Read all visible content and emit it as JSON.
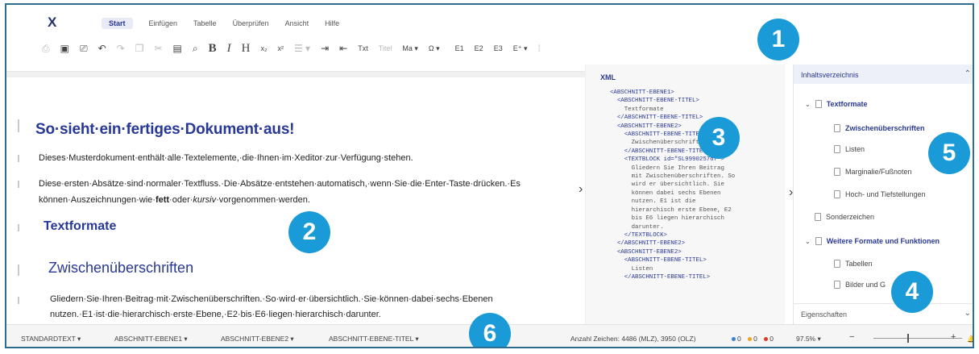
{
  "logo": "X",
  "menu": [
    "Start",
    "Einfügen",
    "Tabelle",
    "Überprüfen",
    "Ansicht",
    "Hilfe"
  ],
  "menu_active": 0,
  "toolbar": {
    "txt": "Txt",
    "titel": "Titel",
    "ma": "Ma ▾",
    "e1": "E1",
    "e2": "E2",
    "e3": "E3",
    "eplus": "E⁺ ▾",
    "h": "H",
    "b": "B",
    "i": "I",
    "sub": "x₂",
    "sup": "x²"
  },
  "editor": {
    "title": "So·sieht·ein·fertiges·Dokument·aus!",
    "p1": "Dieses·Musterdokument·enthält·alle·Textelemente,·die·Ihnen·im·Xeditor·zur·Verfügung·stehen.",
    "p2_line1": "Diese·ersten·Absätze·sind·normaler·Textfluss.·Die·Absätze·entstehen·automatisch,·wenn·Sie·die·Enter-Taste·drücken.·Es",
    "p2_line2_a": "können·Auszeichnungen·wie·",
    "p2_bold": "fett",
    "p2_line2_b": "·oder·",
    "p2_italic": "kursiv",
    "p2_line2_c": "·vorgenommen·werden.",
    "h2": "Textformate",
    "h3": "Zwischenüberschriften",
    "p3_line1": "Gliedern·Sie·Ihren·Beitrag·mit·Zwischenüberschriften.·So·wird·er·übersichtlich.·Sie·können·dabei·sechs·Ebenen",
    "p3_line2": "nutzen.·E1·ist·die·hierarchisch·erste·Ebene,·E2·bis·E6·liegen·hierarchisch·darunter."
  },
  "xml": {
    "title": "XML",
    "lines": [
      {
        "t": "tag",
        "v": "<ABSCHNITT-EBENE1>"
      },
      {
        "t": "tag",
        "v": "  <ABSCHNITT-EBENE-TITEL>"
      },
      {
        "t": "txt",
        "v": "    Textformate"
      },
      {
        "t": "tag",
        "v": "  </ABSCHNITT-EBENE-TITEL>"
      },
      {
        "t": "tag",
        "v": "  <ABSCHNITT-EBENE2>"
      },
      {
        "t": "tag",
        "v": "    <ABSCHNITT-EBENE-TITEL>"
      },
      {
        "t": "txt",
        "v": "      Zwischenüberschriften"
      },
      {
        "t": "tag",
        "v": "    </ABSCHNITT-EBENE-TITEL>"
      },
      {
        "t": "tag",
        "v": "    <TEXTBLOCK id=\"SL999025767\">"
      },
      {
        "t": "txt",
        "v": "      Gliedern Sie Ihren Beitrag"
      },
      {
        "t": "txt",
        "v": "      mit Zwischenüberschriften. So"
      },
      {
        "t": "txt",
        "v": "      wird er übersichtlich. Sie"
      },
      {
        "t": "txt",
        "v": "      können dabei sechs Ebenen"
      },
      {
        "t": "txt",
        "v": "      nutzen. E1 ist die"
      },
      {
        "t": "txt",
        "v": "      hierarchisch erste Ebene, E2"
      },
      {
        "t": "txt",
        "v": "      bis E6 liegen hierarchisch"
      },
      {
        "t": "txt",
        "v": "      darunter."
      },
      {
        "t": "tag",
        "v": "    </TEXTBLOCK>"
      },
      {
        "t": "tag",
        "v": "  </ABSCHNITT-EBENE2>"
      },
      {
        "t": "tag",
        "v": "  <ABSCHNITT-EBENE2>"
      },
      {
        "t": "tag",
        "v": "    <ABSCHNITT-EBENE-TITEL>"
      },
      {
        "t": "txt",
        "v": "      Listen"
      },
      {
        "t": "tag",
        "v": "    </ABSCHNITT-EBENE-TITEL>"
      }
    ]
  },
  "toc": {
    "title": "Inhaltsverzeichnis",
    "items": [
      {
        "label": "Textformate",
        "level": 1,
        "bold": true,
        "caret": true
      },
      {
        "label": "Zwischenüberschriften",
        "level": 2,
        "bold": true,
        "caret": false
      },
      {
        "label": "Listen",
        "level": 2,
        "bold": false,
        "caret": false
      },
      {
        "label": "Marginalie/Fußnoten",
        "level": 2,
        "bold": false,
        "caret": false
      },
      {
        "label": "Hoch- und Tiefstellungen",
        "level": 2,
        "bold": false,
        "caret": false
      },
      {
        "label": "Sonderzeichen",
        "level": 1,
        "bold": false,
        "caret": false
      },
      {
        "label": "Weitere Formate und Funktionen",
        "level": 1,
        "bold": true,
        "caret": true
      },
      {
        "label": "Tabellen",
        "level": 2,
        "bold": false,
        "caret": false
      },
      {
        "label": "Bilder und G",
        "level": 2,
        "bold": false,
        "caret": false
      }
    ],
    "properties": "Eigenschaften"
  },
  "status": {
    "style1": "STANDARDTEXT ▾",
    "style2": "ABSCHNITT-EBENE1 ▾",
    "style3": "ABSCHNITT-EBENE2 ▾",
    "style4": "ABSCHNITT-EBENE-TITEL ▾",
    "chars": "Anzahl Zeichen: 4486 (MLZ), 3950 (OLZ)",
    "count_blue": "0",
    "count_orange": "0",
    "count_red": "0",
    "zoom": "97.5% ▾",
    "minus": "−",
    "plus": "+"
  },
  "callouts": [
    "1",
    "2",
    "3",
    "4",
    "5",
    "6"
  ],
  "colors": {
    "accent": "#283896",
    "callout": "#1a9bd7",
    "frame": "#2d6d92",
    "dot_blue": "#3d7fd1",
    "dot_orange": "#f0a21a",
    "dot_red": "#d83b2c"
  }
}
